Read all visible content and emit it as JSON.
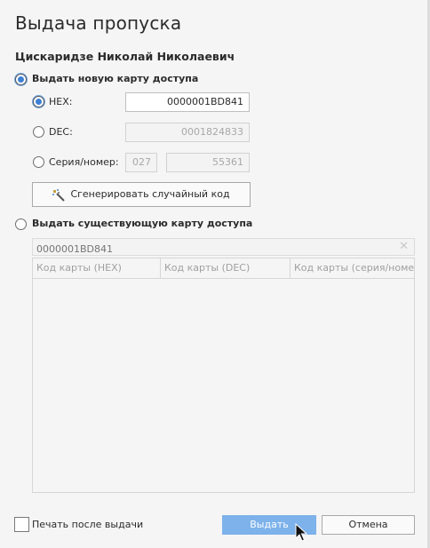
{
  "dialog": {
    "title": "Выдача пропуска",
    "person_name": "Цискаридзе Николай Николаевич"
  },
  "new_card": {
    "option_label": "Выдать новую карту доступа",
    "selected": true,
    "hex": {
      "label": "HEX:",
      "value": "0000001BD841",
      "selected": true
    },
    "dec": {
      "label": "DEC:",
      "value": "0001824833",
      "selected": false
    },
    "series": {
      "label": "Серия/номер:",
      "series_value": "027",
      "number_value": "55361",
      "selected": false
    },
    "generate_button": "Сгенерировать случайный код"
  },
  "existing_card": {
    "option_label": "Выдать существующую карту доступа",
    "selected": false,
    "search_placeholder": "0000001BD841",
    "clear_icon": "close-icon",
    "columns": [
      "Код карты (HEX)",
      "Код карты (DEC)",
      "Код карты (серия/номер"
    ],
    "rows": []
  },
  "footer": {
    "print_after_issue_label": "Печать после выдачи",
    "print_after_issue_checked": false,
    "issue_button": "Выдать",
    "cancel_button": "Отмена"
  },
  "colors": {
    "accent": "#3d80d6",
    "primary_button": "#7db2ea",
    "background": "#f5f5f5"
  }
}
